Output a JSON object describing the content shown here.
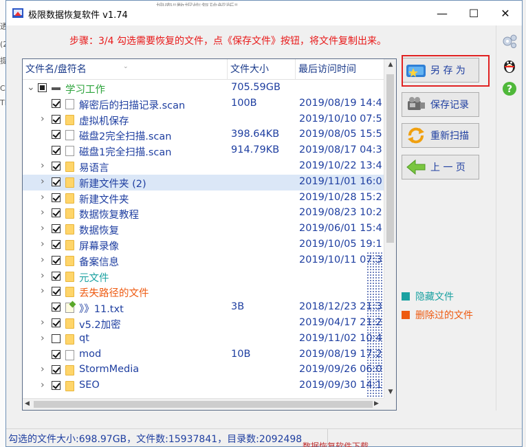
{
  "background": {
    "left_fragments": [
      "透",
      "(2",
      "提",
      "CA",
      "TE"
    ],
    "title_fragment": "搜索\"数据恢复破解版\"",
    "status_fragment": "数据恢复软件下载"
  },
  "window": {
    "title": "极限数据恢复软件 v1.74",
    "minimize_label": "—",
    "maximize_label": "☐",
    "close_label": "✕"
  },
  "step_text": "步骤：3/4 勾选需要恢复的文件，点《保存文件》按钮，将文件复制出来。",
  "columns": [
    "文件名/盘符名",
    "文件大小",
    "最后访问时间"
  ],
  "rows": [
    {
      "level": 0,
      "expander": "⌄",
      "check": "partial",
      "icon": "drive",
      "name": "学习工作",
      "size": "705.59GB",
      "time": "",
      "color": "green"
    },
    {
      "level": 1,
      "expander": "",
      "check": "checked",
      "icon": "file",
      "name": "解密后的扫描记录.scan",
      "size": "100B",
      "time": "2019/08/19 14:4",
      "color": ""
    },
    {
      "level": 1,
      "expander": "›",
      "check": "checked",
      "icon": "folder",
      "name": "虚拟机保存",
      "size": "",
      "time": "2019/10/10 07:5",
      "color": ""
    },
    {
      "level": 1,
      "expander": "",
      "check": "checked",
      "icon": "file",
      "name": "磁盘2完全扫描.scan",
      "size": "398.64KB",
      "time": "2019/08/05 15:5",
      "color": ""
    },
    {
      "level": 1,
      "expander": "",
      "check": "checked",
      "icon": "file",
      "name": "磁盘1完全扫描.scan",
      "size": "914.79KB",
      "time": "2019/08/17 04:3",
      "color": ""
    },
    {
      "level": 1,
      "expander": "›",
      "check": "checked",
      "icon": "folder",
      "name": "易语言",
      "size": "",
      "time": "2019/10/22 13:4",
      "color": ""
    },
    {
      "level": 1,
      "expander": "›",
      "check": "checked",
      "icon": "folder",
      "name": "新建文件夹 (2)",
      "size": "",
      "time": "2019/11/01 16:0",
      "color": "",
      "selected": true
    },
    {
      "level": 1,
      "expander": "›",
      "check": "checked",
      "icon": "folder",
      "name": "新建文件夹",
      "size": "",
      "time": "2019/10/28 15:2",
      "color": ""
    },
    {
      "level": 1,
      "expander": "›",
      "check": "checked",
      "icon": "folder",
      "name": "数据恢复教程",
      "size": "",
      "time": "2019/08/23 10:2",
      "color": ""
    },
    {
      "level": 1,
      "expander": "›",
      "check": "checked",
      "icon": "folder",
      "name": "数据恢复",
      "size": "",
      "time": "2019/06/01 15:4",
      "color": ""
    },
    {
      "level": 1,
      "expander": "›",
      "check": "checked",
      "icon": "folder",
      "name": "屏幕录像",
      "size": "",
      "time": "2019/10/05 19:1",
      "color": ""
    },
    {
      "level": 1,
      "expander": "›",
      "check": "checked",
      "icon": "folder",
      "name": "备案信息",
      "size": "",
      "time": "2019/10/11 07:3",
      "color": ""
    },
    {
      "level": 1,
      "expander": "›",
      "check": "checked",
      "icon": "folder",
      "name": "元文件",
      "size": "",
      "time": "",
      "color": "teal"
    },
    {
      "level": 1,
      "expander": "›",
      "check": "checked",
      "icon": "folder",
      "name": "丢失路径的文件",
      "size": "",
      "time": "",
      "color": "orange"
    },
    {
      "level": 1,
      "expander": "",
      "check": "checked",
      "icon": "txt",
      "name": "》》11.txt",
      "size": "3B",
      "time": "2018/12/23 21:3",
      "color": ""
    },
    {
      "level": 1,
      "expander": "›",
      "check": "checked",
      "icon": "folder",
      "name": "v5.2加密",
      "size": "",
      "time": "2019/04/17 21:2",
      "color": ""
    },
    {
      "level": 1,
      "expander": "›",
      "check": "unchecked",
      "icon": "folder",
      "name": "qt",
      "size": "",
      "time": "2019/11/02 10:4",
      "color": ""
    },
    {
      "level": 1,
      "expander": "",
      "check": "checked",
      "icon": "file",
      "name": "mod",
      "size": "10B",
      "time": "2019/08/19 17:2",
      "color": ""
    },
    {
      "level": 1,
      "expander": "›",
      "check": "checked",
      "icon": "folder",
      "name": "StormMedia",
      "size": "",
      "time": "2019/09/26 06:0",
      "color": ""
    },
    {
      "level": 1,
      "expander": "›",
      "check": "checked",
      "icon": "folder",
      "name": "SEO",
      "size": "",
      "time": "2019/09/30 14:1",
      "color": ""
    }
  ],
  "buttons": {
    "save_as": "另 存 为",
    "save_record": "保存记录",
    "rescan": "重新扫描",
    "prev_page": "上 一 页"
  },
  "legend": {
    "hidden": {
      "label": "隐藏文件",
      "color": "#1aa1a1"
    },
    "deleted": {
      "label": "删除过的文件",
      "color": "#ee5a10"
    }
  },
  "status": "勾选的文件大小:698.97GB，文件数:15937841，目录数:2092498",
  "colors": {
    "accent_text": "#1e3ea0",
    "step_red": "#e81818",
    "highlight_red": "#e02020"
  }
}
